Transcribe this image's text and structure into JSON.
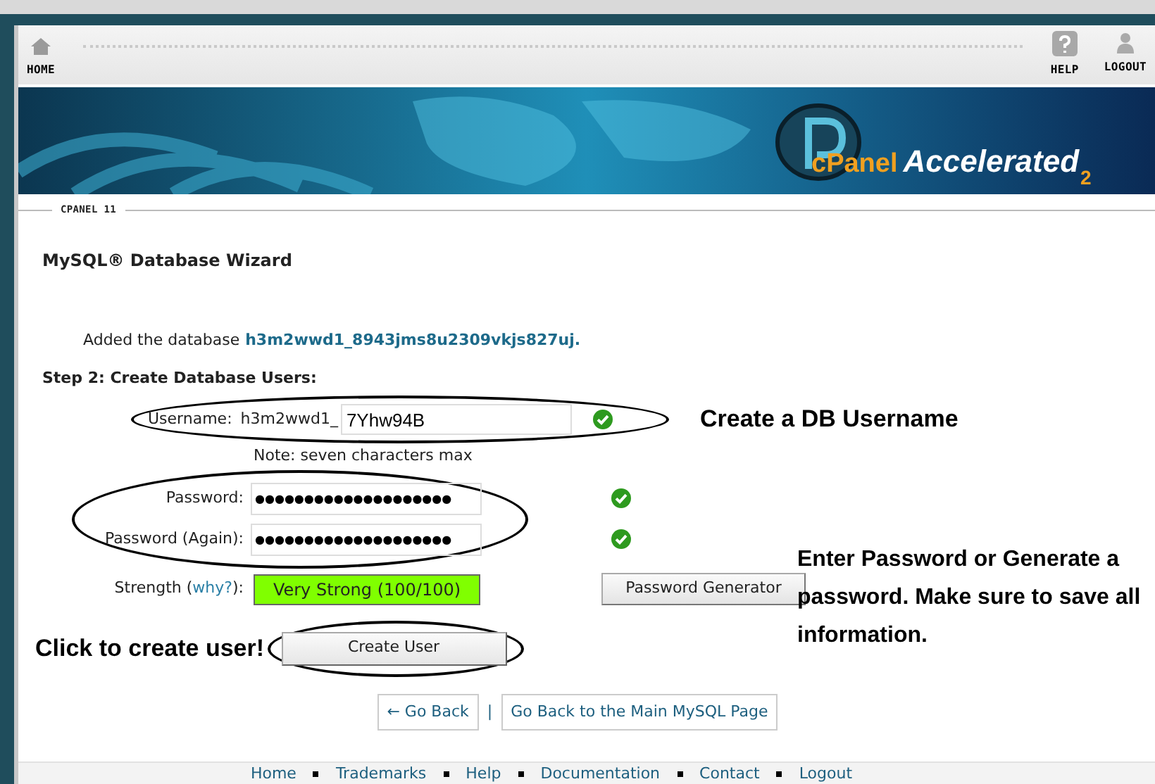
{
  "nav": [
    {
      "kind": "home",
      "label": "HOME"
    },
    {
      "kind": "help",
      "label": "HELP"
    },
    {
      "kind": "logout",
      "label": "LOGOUT"
    }
  ],
  "banner": {
    "logo_word": "cPanel",
    "logo_tagline": "Accelerated",
    "logo_version": "2"
  },
  "section_label": "CPANEL 11",
  "title": "MySQL® Database Wizard",
  "added": {
    "text": "Added the database",
    "database": "h3m2wwd1_8943jms8u2309vkjs827uj."
  },
  "step": "Step 2: Create Database Users:",
  "username": {
    "label": "Username:",
    "prefix": "h3m2wwd1_",
    "value": "7Yhw94B",
    "valid": true
  },
  "note": "Note: seven characters max",
  "passwords": [
    {
      "label": "Password:",
      "value": "●●●●●●●●●●●●●●●●●●●●",
      "valid": true
    },
    {
      "label": "Password (Again):",
      "value": "●●●●●●●●●●●●●●●●●●●●",
      "valid": true
    }
  ],
  "strength": {
    "label_before": "Strength (",
    "link": "why?",
    "label_after": "):",
    "text": "Very Strong (100/100)",
    "level": 1
  },
  "generator_button": "Password Generator",
  "create_button": "Create User",
  "back_links": [
    "← Go Back",
    "Go Back to the Main MySQL Page"
  ],
  "back_separator": "|",
  "footer": [
    "Home",
    "Trademarks",
    "Help",
    "Documentation",
    "Contact",
    "Logout"
  ],
  "annotations": [
    {
      "kind": "username",
      "text": "Create a DB Username"
    },
    {
      "kind": "password",
      "text": "Enter Password or Generate a password. Make sure to save all information."
    },
    {
      "kind": "create",
      "text": "Click to create user!"
    }
  ]
}
